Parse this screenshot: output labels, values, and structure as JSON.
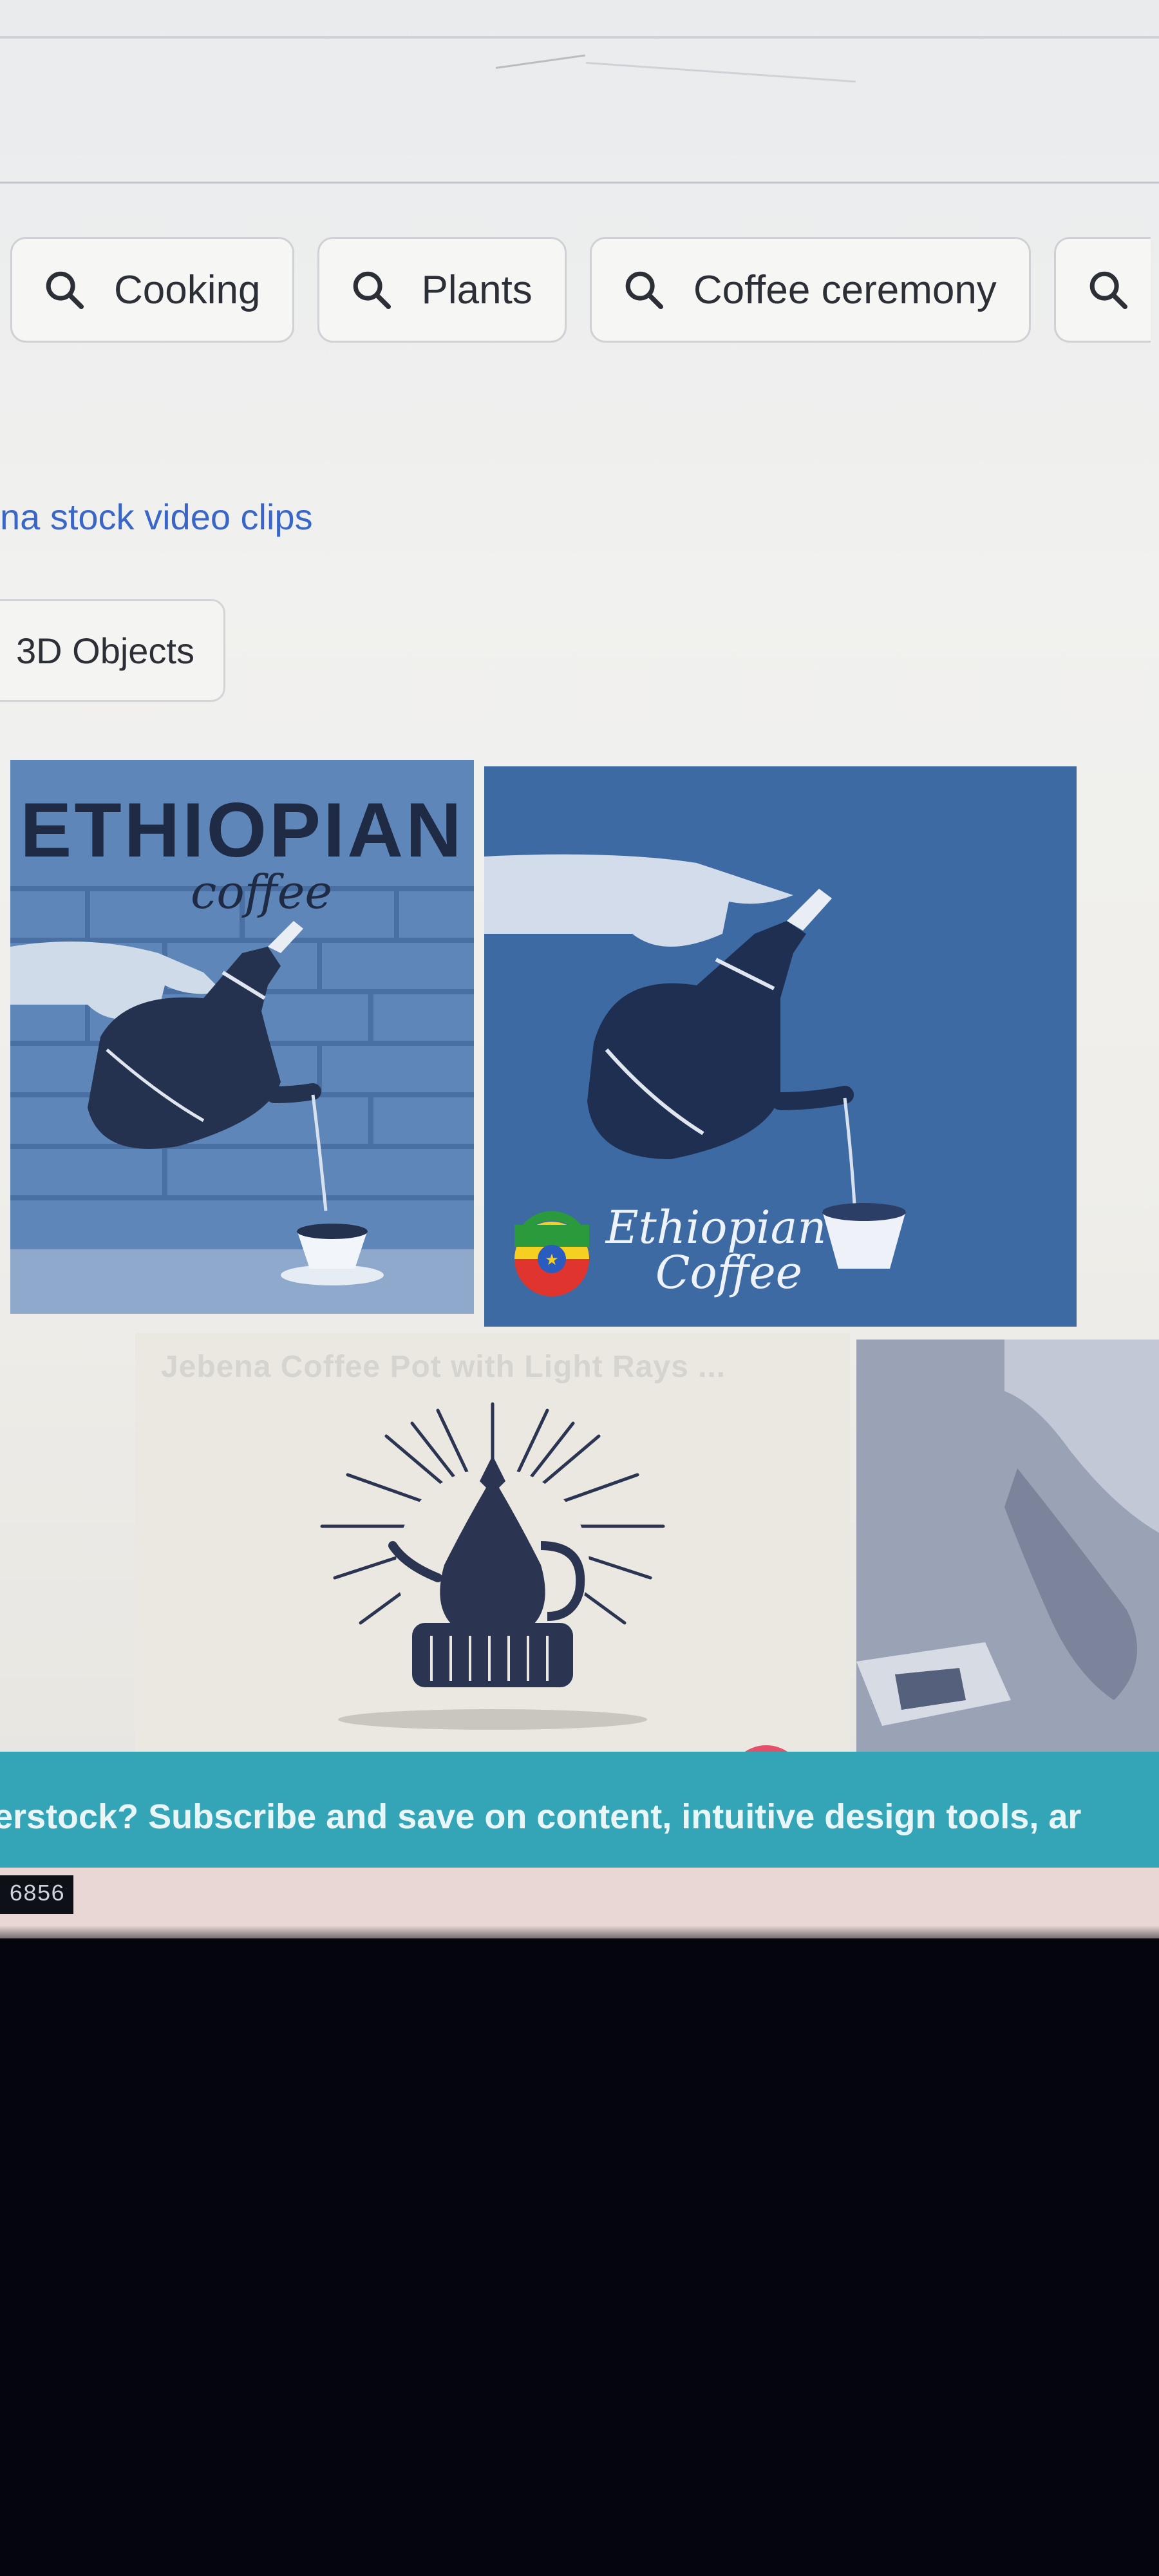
{
  "search_chips": [
    {
      "label": "Cooking",
      "icon": "search-icon"
    },
    {
      "label": "Plants",
      "icon": "search-icon"
    },
    {
      "label": "Coffee ceremony",
      "icon": "search-icon"
    },
    {
      "label": "",
      "icon": "search-icon"
    }
  ],
  "video_link": "na stock video clips",
  "filter_chip": "3D Objects",
  "images": [
    {
      "heading": "ETHIOPIAN",
      "subheading": "coffee"
    },
    {
      "line1": "Ethiopian",
      "line2": "Coffee"
    },
    {
      "title": "Jebena Coffee Pot with Light Rays ..."
    }
  ],
  "banner": "erstock? Subscribe and save on content, intuitive design tools, ar",
  "counter": "6856",
  "colors": {
    "accent_link": "#3a66c7",
    "banner": "#34a5b7",
    "tile_blue": "#3e6aa4"
  }
}
